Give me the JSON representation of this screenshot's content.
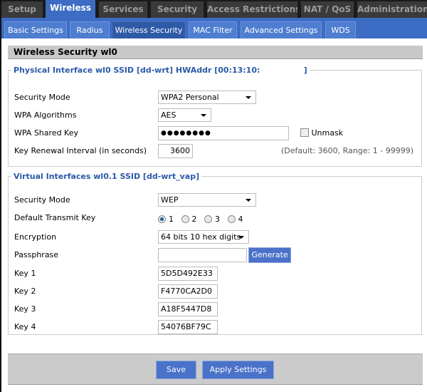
{
  "main_tabs": [
    "Setup",
    "Wireless",
    "Services",
    "Security",
    "Access Restrictions",
    "NAT / QoS",
    "Administration"
  ],
  "active_main_tab": "Wireless",
  "sub_tabs": [
    "Basic Settings",
    "Radius",
    "Wireless Security",
    "MAC Filter",
    "Advanced Settings",
    "WDS"
  ],
  "active_sub_tab": "Wireless Security",
  "section_title": "Wireless Security wl0",
  "physical": {
    "legend": "Physical Interface wl0 SSID [dd-wrt] HWAddr [00:13:10:                ]",
    "security_mode_label": "Security Mode",
    "security_mode": "WPA2 Personal",
    "wpa_alg_label": "WPA Algorithms",
    "wpa_alg": "AES",
    "shared_key_label": "WPA Shared Key",
    "shared_key": "●●●●●●●●",
    "unmask_label": "Unmask",
    "renewal_label": "Key Renewal Interval (in seconds)",
    "renewal": "3600",
    "renewal_hint": "(Default: 3600, Range: 1 - 99999)"
  },
  "virtual": {
    "legend": "Virtual Interfaces wl0.1 SSID [dd-wrt_vap]",
    "security_mode_label": "Security Mode",
    "security_mode": "WEP",
    "tx_key_label": "Default Transmit Key",
    "tx_keys": [
      "1",
      "2",
      "3",
      "4"
    ],
    "tx_key_selected": "1",
    "encryption_label": "Encryption",
    "encryption": "64 bits 10 hex digits",
    "passphrase_label": "Passphrase",
    "passphrase": "",
    "generate_label": "Generate",
    "keys": [
      {
        "label": "Key 1",
        "value": "5D5D492E33"
      },
      {
        "label": "Key 2",
        "value": "F4770CA2D0"
      },
      {
        "label": "Key 3",
        "value": "A18F5447D8"
      },
      {
        "label": "Key 4",
        "value": "54076BF79C"
      }
    ]
  },
  "buttons": {
    "save": "Save",
    "apply": "Apply Settings"
  },
  "colors": {
    "accent": "#3c6cc4",
    "legend": "#2a5aa8",
    "dark_tab": "#3a3a3a"
  }
}
